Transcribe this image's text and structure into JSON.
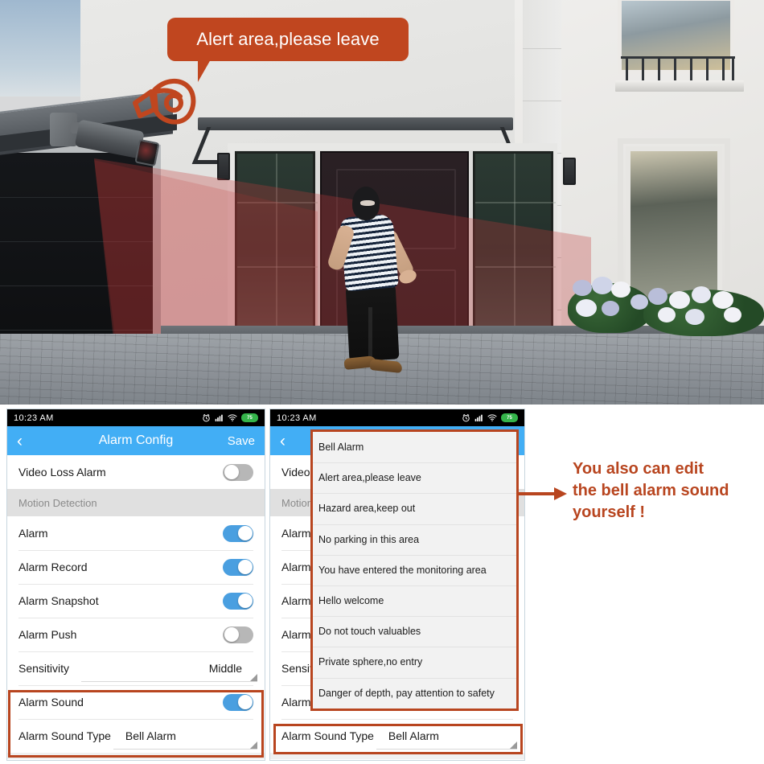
{
  "scene": {
    "bubble_text": "Alert area,please leave",
    "megaphone_icon": "megaphone-icon",
    "camera_icon": "security-camera",
    "intruder": "masked-intruder"
  },
  "annotation": {
    "lines": [
      "You also can edit",
      "the bell alarm sound",
      "yourself !"
    ],
    "arrow": "arrow-right-icon",
    "color": "#b8451f"
  },
  "phone1": {
    "statusbar": {
      "time": "10:23  AM",
      "alarm_icon": "alarm-clock-icon",
      "signal_icon": "signal-bars-icon",
      "wifi_icon": "wifi-icon",
      "battery_icon": "battery-icon",
      "battery_level": "75"
    },
    "navbar": {
      "back_icon": "chevron-left-icon",
      "title": "Alarm Config",
      "save_label": "Save"
    },
    "rows": [
      {
        "label": "Video Loss Alarm",
        "control": "toggle",
        "state": "off"
      },
      {
        "label": "Motion Detection",
        "control": "section"
      },
      {
        "label": "Alarm",
        "control": "toggle",
        "state": "on"
      },
      {
        "label": "Alarm Record",
        "control": "toggle",
        "state": "on"
      },
      {
        "label": "Alarm Snapshot",
        "control": "toggle",
        "state": "on"
      },
      {
        "label": "Alarm Push",
        "control": "toggle",
        "state": "off"
      },
      {
        "label": "Sensitivity",
        "control": "select",
        "value": "Middle"
      },
      {
        "label": "Alarm Sound",
        "control": "toggle",
        "state": "on"
      },
      {
        "label": "Alarm Sound Type",
        "control": "select",
        "value": "Bell Alarm"
      }
    ]
  },
  "phone2": {
    "statusbar": {
      "time": "10:23  AM",
      "alarm_icon": "alarm-clock-icon",
      "signal_icon": "signal-bars-icon",
      "wifi_icon": "wifi-icon",
      "battery_icon": "battery-icon",
      "battery_level": "75"
    },
    "navbar": {
      "back_icon": "chevron-left-icon"
    },
    "rows": [
      {
        "label": "Video",
        "control": "none"
      },
      {
        "label": "Motion",
        "control": "section"
      },
      {
        "label": "Alarm",
        "control": "none"
      },
      {
        "label": "Alarm",
        "control": "none"
      },
      {
        "label": "Alarm",
        "control": "none"
      },
      {
        "label": "Alarm",
        "control": "none"
      },
      {
        "label": "Sensit",
        "control": "none"
      },
      {
        "label": "Alarm",
        "control": "none"
      }
    ],
    "bottom_row": {
      "label": "Alarm Sound Type",
      "value": "Bell Alarm"
    },
    "dropdown": {
      "options": [
        "Bell Alarm",
        "Alert area,please leave",
        "Hazard area,keep out",
        "No parking in this area",
        "You have entered the monitoring area",
        "Hello welcome",
        "Do not touch valuables",
        "Private sphere,no entry",
        "Danger of depth, pay attention to safety"
      ]
    }
  }
}
